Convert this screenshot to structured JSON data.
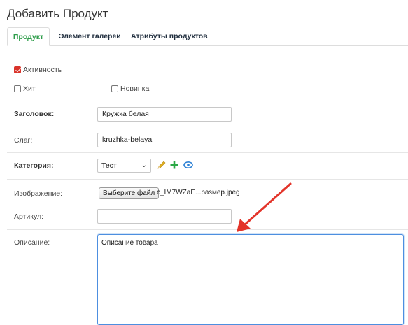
{
  "page": {
    "title": "Добавить Продукт"
  },
  "tabs": [
    {
      "label": "Продукт",
      "active": true
    },
    {
      "label": "Элемент галереи",
      "active": false
    },
    {
      "label": "Атрибуты продуктов",
      "active": false
    }
  ],
  "form": {
    "active": {
      "label": "Активность",
      "checked": true
    },
    "hit": {
      "label": "Хит",
      "checked": false
    },
    "new": {
      "label": "Новинка",
      "checked": false
    },
    "title": {
      "label": "Заголовок:",
      "value": "Кружка белая"
    },
    "slug": {
      "label": "Слаг:",
      "value": "kruzhka-belaya"
    },
    "category": {
      "label": "Категория:",
      "selected": "Тест"
    },
    "image": {
      "label": "Изображение:",
      "button": "Выберите файл",
      "filename": "c_IM7WZaE...размер.jpeg"
    },
    "sku": {
      "label": "Артикул:",
      "value": ""
    },
    "description": {
      "label": "Описание:",
      "value": "Описание товара"
    }
  },
  "colors": {
    "accent_tab": "#2e9d4a",
    "checkbox": "#d9342b",
    "pencil": "#e0b020",
    "plus": "#2aa845",
    "eye": "#2a7fd4",
    "arrow": "#e3342a",
    "focus": "#4d8fe0"
  },
  "icons": {
    "edit": "pencil-icon",
    "add": "plus-icon",
    "view": "eye-icon"
  }
}
